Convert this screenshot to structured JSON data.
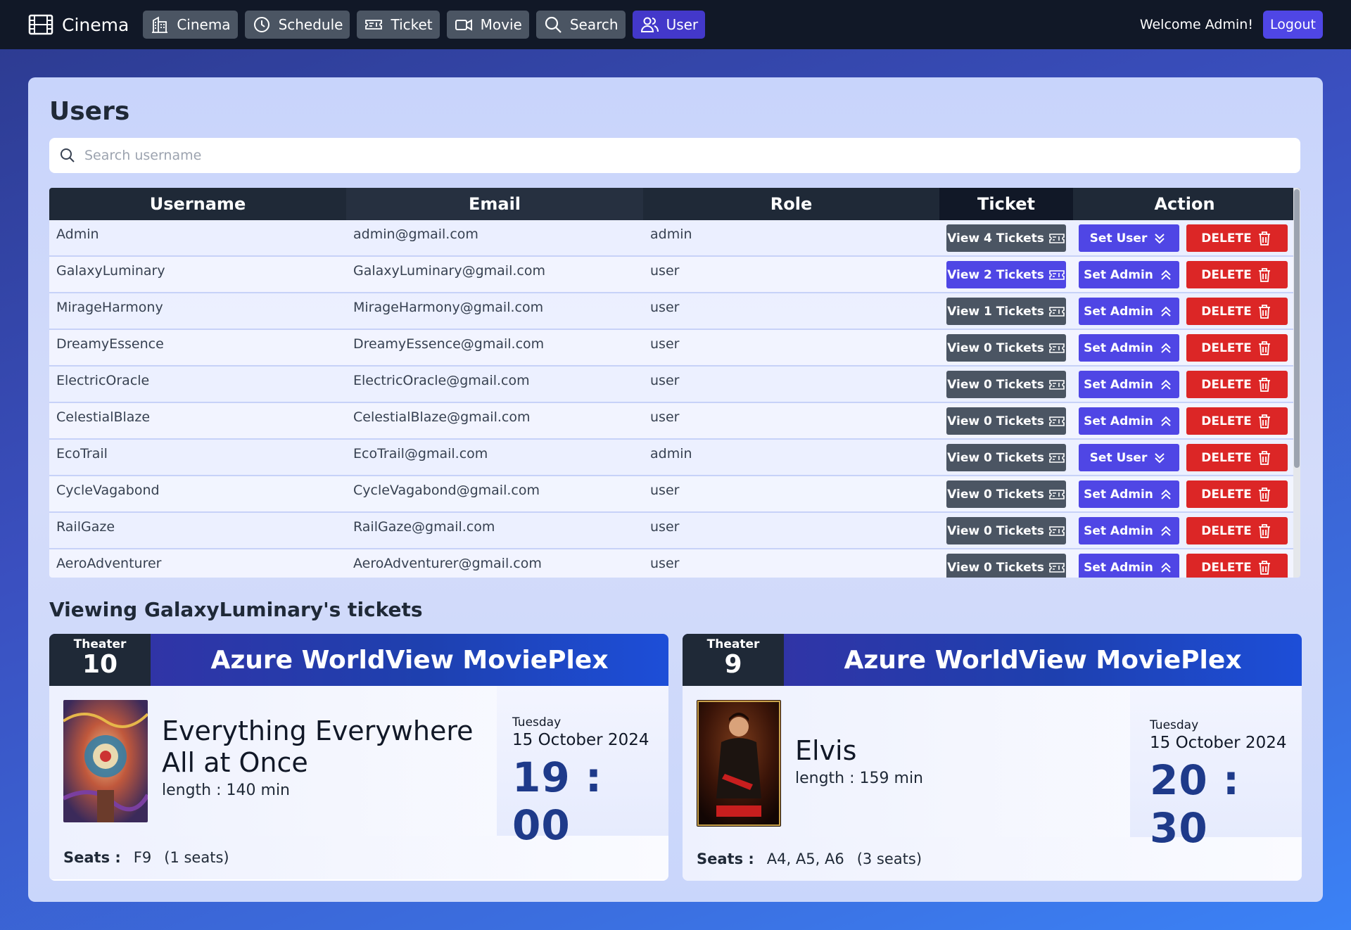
{
  "nav": {
    "brand": "Cinema",
    "items": [
      {
        "label": "Cinema",
        "icon": "building-icon"
      },
      {
        "label": "Schedule",
        "icon": "clock-icon"
      },
      {
        "label": "Ticket",
        "icon": "ticket-icon"
      },
      {
        "label": "Movie",
        "icon": "video-camera-icon"
      },
      {
        "label": "Search",
        "icon": "search-icon"
      },
      {
        "label": "User",
        "icon": "users-icon",
        "active": true
      }
    ],
    "welcome": "Welcome Admin!",
    "logout": "Logout"
  },
  "users": {
    "title": "Users",
    "search_placeholder": "Search username",
    "columns": [
      "Username",
      "Email",
      "Role",
      "Ticket",
      "Action"
    ],
    "rows": [
      {
        "username": "Admin",
        "email": "admin@gmail.com",
        "role": "admin",
        "ticket": "View 4 Tickets",
        "action": "Set User",
        "delete": "DELETE"
      },
      {
        "username": "GalaxyLuminary",
        "email": "GalaxyLuminary@gmail.com",
        "role": "user",
        "ticket": "View 2 Tickets",
        "action": "Set Admin",
        "delete": "DELETE"
      },
      {
        "username": "MirageHarmony",
        "email": "MirageHarmony@gmail.com",
        "role": "user",
        "ticket": "View 1 Tickets",
        "action": "Set Admin",
        "delete": "DELETE"
      },
      {
        "username": "DreamyEssence",
        "email": "DreamyEssence@gmail.com",
        "role": "user",
        "ticket": "View 0 Tickets",
        "action": "Set Admin",
        "delete": "DELETE"
      },
      {
        "username": "ElectricOracle",
        "email": "ElectricOracle@gmail.com",
        "role": "user",
        "ticket": "View 0 Tickets",
        "action": "Set Admin",
        "delete": "DELETE"
      },
      {
        "username": "CelestialBlaze",
        "email": "CelestialBlaze@gmail.com",
        "role": "user",
        "ticket": "View 0 Tickets",
        "action": "Set Admin",
        "delete": "DELETE"
      },
      {
        "username": "EcoTrail",
        "email": "EcoTrail@gmail.com",
        "role": "admin",
        "ticket": "View 0 Tickets",
        "action": "Set User",
        "delete": "DELETE"
      },
      {
        "username": "CycleVagabond",
        "email": "CycleVagabond@gmail.com",
        "role": "user",
        "ticket": "View 0 Tickets",
        "action": "Set Admin",
        "delete": "DELETE"
      },
      {
        "username": "RailGaze",
        "email": "RailGaze@gmail.com",
        "role": "user",
        "ticket": "View 0 Tickets",
        "action": "Set Admin",
        "delete": "DELETE"
      },
      {
        "username": "AeroAdventurer",
        "email": "AeroAdventurer@gmail.com",
        "role": "user",
        "ticket": "View 0 Tickets",
        "action": "Set Admin",
        "delete": "DELETE"
      }
    ]
  },
  "viewing": {
    "title": "Viewing GalaxyLuminary's tickets",
    "tickets": [
      {
        "theater_label": "Theater",
        "theater": "10",
        "cinema": "Azure WorldView MoviePlex",
        "movie": "Everything Everywhere All at Once",
        "length": "length : 140 min",
        "day": "Tuesday",
        "date": "15 October 2024",
        "time": "19 : 00",
        "seats_label": "Seats :",
        "seats": "F9",
        "seat_count": "(1 seats)"
      },
      {
        "theater_label": "Theater",
        "theater": "9",
        "cinema": "Azure WorldView MoviePlex",
        "movie": "Elvis",
        "length": "length : 159 min",
        "day": "Tuesday",
        "date": "15 October 2024",
        "time": "20 : 30",
        "seats_label": "Seats :",
        "seats": "A4, A5, A6",
        "seat_count": "(3 seats)"
      }
    ]
  },
  "colors": {
    "nav_bg": "#111827",
    "accent": "#4f46e5",
    "danger": "#dc2626",
    "time": "#1e3a8a"
  }
}
